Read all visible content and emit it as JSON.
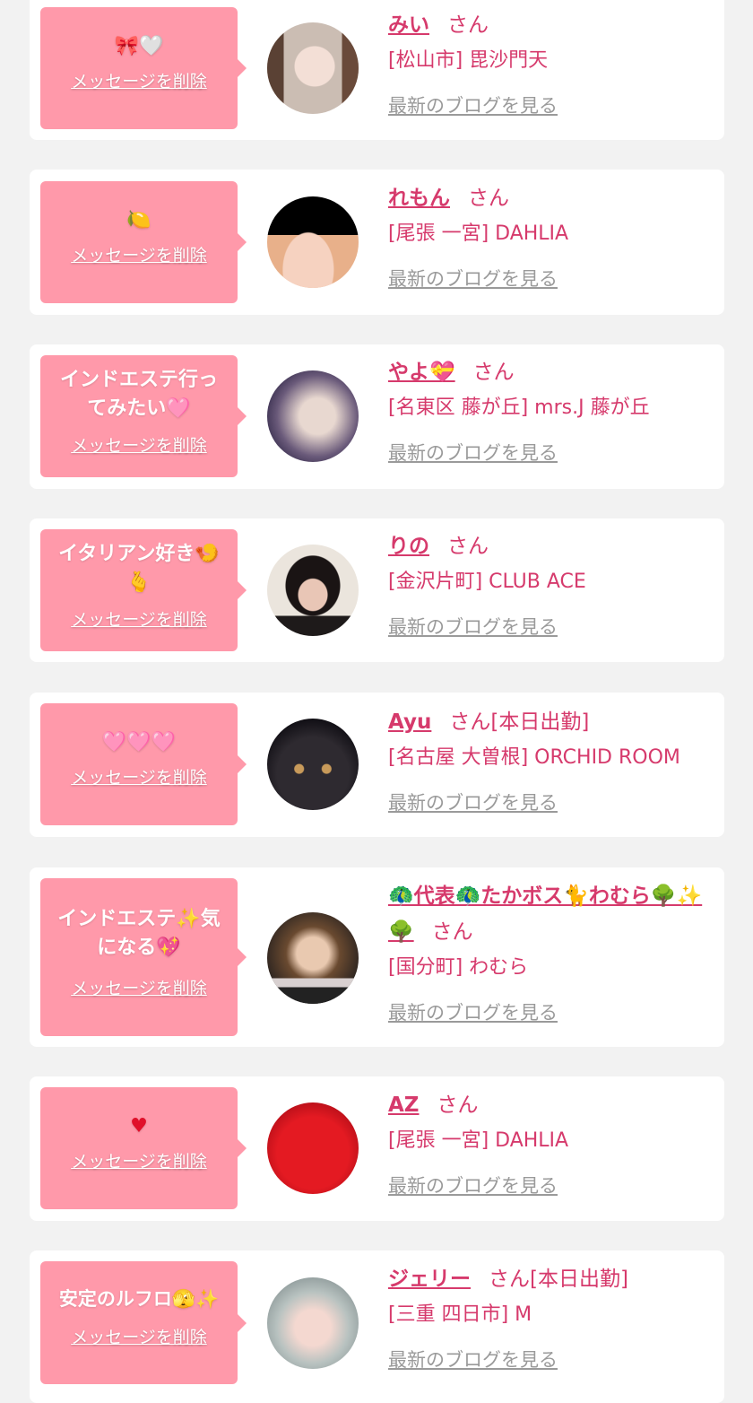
{
  "common": {
    "delete_label": "メッセージを削除",
    "blog_label": "最新のブログを見る",
    "san_label": "さん"
  },
  "colors": {
    "page_bg": "#f2f2f2",
    "card_bg": "#ffffff",
    "bubble_bg": "#ff99aa",
    "accent": "#d63a6c",
    "link_gray": "#9a9a9a"
  },
  "entries": [
    {
      "message": "🎀🤍",
      "name": "みい",
      "suffix": "さん",
      "shop": "[松山市] 毘沙門天",
      "avatar_icon": "woman-photo-icon"
    },
    {
      "message": "🍋",
      "name": "れもん",
      "suffix": "さん",
      "shop": "[尾張 一宮] DAHLIA",
      "avatar_icon": "woman-photo-icon"
    },
    {
      "message": "インドエステ行ってみたい🩷",
      "name": "やよ💝",
      "suffix": "さん",
      "shop": "[名東区 藤が丘] mrs.J 藤が丘",
      "avatar_icon": "woman-photo-icon"
    },
    {
      "message": "イタリアン好き🍤🫰",
      "name": "りの",
      "suffix": "さん",
      "shop": "[金沢片町] CLUB ACE",
      "avatar_icon": "woman-photo-icon"
    },
    {
      "message": "🩷🩷🩷",
      "name": "Ayu",
      "suffix": "さん[本日出勤]",
      "shop": "[名古屋 大曽根] ORCHID ROOM",
      "avatar_icon": "dog-photo-icon"
    },
    {
      "message": "インドエステ✨気になる💖",
      "name": "🦚代表🦚たかボス🐈わむら🌳✨🌳",
      "suffix": "さん",
      "shop": "[国分町] わむら",
      "avatar_icon": "woman-photo-icon"
    },
    {
      "message": "♥",
      "name": "AZ",
      "suffix": "さん",
      "shop": "[尾張 一宮] DAHLIA",
      "avatar_icon": "red-heart-photo-icon"
    },
    {
      "message": "安定のルフロ🫣✨",
      "name": "ジェリー",
      "suffix": "さん[本日出勤]",
      "shop": "[三重 四日市] M",
      "avatar_icon": "woman-photo-icon"
    }
  ]
}
